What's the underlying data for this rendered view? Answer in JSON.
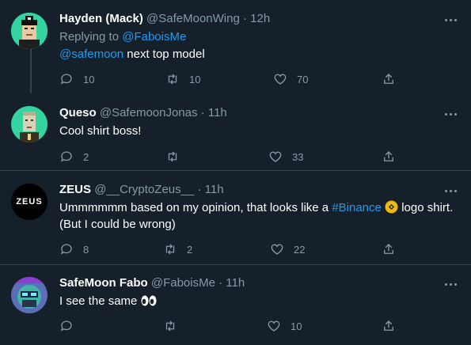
{
  "colors": {
    "background": "#15202b",
    "link": "#1d9bf0",
    "muted": "#8899a6",
    "divider": "#38444d"
  },
  "tweets": [
    {
      "name": "Hayden (Mack)",
      "handle": "@SafeMoonWing",
      "time": "12h",
      "replying_prefix": "Replying to ",
      "replying_handle": "@FaboisMe",
      "mention": "@safemoon",
      "text": " next top model",
      "reply_count": "10",
      "retweet_count": "10",
      "like_count": "70"
    },
    {
      "name": "Queso",
      "handle": "@SafemoonJonas",
      "time": "11h",
      "text": "Cool shirt boss!",
      "reply_count": "2",
      "retweet_count": "",
      "like_count": "33"
    },
    {
      "name": "ZEUS",
      "handle": "@__CryptoZeus__",
      "time": "11h",
      "avatar_text": "ZEUS",
      "text_before": "Ummmmmm based on my opinion, that looks like a ",
      "hashtag": "#Binance",
      "text_after": " logo shirt.",
      "text_line2": "(But I could be wrong)",
      "reply_count": "8",
      "retweet_count": "2",
      "like_count": "22"
    },
    {
      "name": "SafeMoon Fabo",
      "handle": "@FaboisMe",
      "time": "11h",
      "text": "I see the same ",
      "reply_count": "",
      "retweet_count": "",
      "like_count": "10"
    }
  ],
  "separator": "·"
}
